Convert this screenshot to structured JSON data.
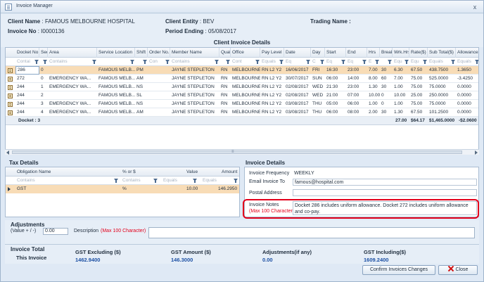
{
  "window": {
    "title": "Invoice Manager",
    "close_glyph": "x"
  },
  "header": {
    "client_name_label": "Client Name",
    "client_name": "FAMOUS MELBOURNE HOSPITAL",
    "client_entity_label": "Client Entity",
    "client_entity": "BEV",
    "trading_name_label": "Trading Name :",
    "invoice_no_label": "Invoice No",
    "invoice_no": "I0000136",
    "period_ending_label": "Period Ending",
    "period_ending": "05/08/2017",
    "colon": ":"
  },
  "client_invoice_details": {
    "title": "Client Invoice Details",
    "columns": [
      "Docket No",
      "Seq.",
      "Area",
      "Service Location",
      "Shift",
      "Order No.",
      "Member Name",
      "Qual",
      "Office",
      "Pay Level",
      "Date",
      "Day",
      "Start",
      "End",
      "Hrs",
      "Break",
      "Wrk.Hrs",
      "Rate($)",
      "Sub Total($)",
      "Allowances ($"
    ],
    "filter_placeholders": [
      "Contai",
      "",
      "Contains",
      "",
      "",
      "Con",
      "Contains",
      "",
      "Cont",
      "Equals",
      "Eq",
      "C",
      "Eq",
      "Eq",
      "E",
      "",
      "Equ",
      "Equ",
      "Equals",
      "Equals"
    ],
    "rows": [
      [
        "286",
        "0",
        "",
        "FAMOUS MELB...",
        "PM",
        "",
        "JAYNE STEPLETON",
        "RN",
        "MELBOURNE",
        "RN L2 Y2",
        "16/06/2017",
        "FRI",
        "16:30",
        "23:00",
        "7.00",
        "30",
        "6.30",
        "67.50",
        "438.7500",
        "1.3650"
      ],
      [
        "272",
        "0",
        "EMERGENCY WA...",
        "FAMOUS MELB...",
        "AM",
        "",
        "JAYNE STEPLETON",
        "RN",
        "MELBOURNE",
        "RN L2 Y2",
        "30/07/2017",
        "SUN",
        "06:00",
        "14:00",
        "8.00",
        "60",
        "7.00",
        "75.00",
        "525.0000",
        "-3.4250"
      ],
      [
        "244",
        "1",
        "EMERGENCY WA...",
        "FAMOUS MELB...",
        "NS",
        "",
        "JAYNE STEPLETON",
        "RN",
        "MELBOURNE",
        "RN L2 Y2",
        "02/08/2017",
        "WED",
        "21:30",
        "23:00",
        "1.30",
        "30",
        "1.00",
        "75.00",
        "75.0000",
        "0.0000"
      ],
      [
        "244",
        "2",
        "",
        "FAMOUS MELB...",
        "SL",
        "",
        "JAYNE STEPLETON",
        "RN",
        "MELBOURNE",
        "RN L2 Y2",
        "02/08/2017",
        "WED",
        "21:00",
        "07:00",
        "10.00",
        "0",
        "10.00",
        "25.00",
        "250.0000",
        "0.0000"
      ],
      [
        "244",
        "3",
        "EMERGENCY WA...",
        "FAMOUS MELB...",
        "NS",
        "",
        "JAYNE STEPLETON",
        "RN",
        "MELBOURNE",
        "RN L2 Y2",
        "03/08/2017",
        "THU",
        "05:00",
        "06:00",
        "1.00",
        "0",
        "1.00",
        "75.00",
        "75.0000",
        "0.0000"
      ],
      [
        "244",
        "4",
        "EMERGENCY WA...",
        "FAMOUS MELB...",
        "AM",
        "",
        "JAYNE STEPLETON",
        "RN",
        "MELBOURNE",
        "RN L2 Y2",
        "03/08/2017",
        "THU",
        "06:00",
        "08:00",
        "2.00",
        "30",
        "1.30",
        "67.50",
        "101.2500",
        "0.0000"
      ]
    ],
    "totals": {
      "docket_label": "Docket : 3",
      "wrk_hrs": "27.00",
      "rate": "$64.17",
      "sub_total": "$1,465.0000",
      "allowances": "-$2.0600"
    },
    "scroll_mid": "≡"
  },
  "tax_details": {
    "title": "Tax Details",
    "columns": [
      "Obligation Name",
      "% or $",
      "Value",
      "Amount"
    ],
    "filters": [
      "Contains",
      "Contains",
      "Equals",
      "Equals"
    ],
    "rows": [
      [
        "GST",
        "%",
        "10.00",
        "146.2950"
      ]
    ]
  },
  "invoice_details": {
    "title": "Invoice Details",
    "frequency_label": "Invoice Frequency",
    "frequency": "WEEKLY",
    "email_label": "Email Invoice To",
    "email": "famous@hospital.com",
    "postal_label": "Postal Address",
    "postal": "",
    "notes_label": "Invoice Notes",
    "notes_hint": "(Max 100 Character)",
    "notes": "Docket 286 includes uniform allowance. Docket 272 includes uniform allowance and co-pay."
  },
  "adjustments": {
    "title": "Adjustments",
    "sign_label": "(Value + / -)",
    "value": "0.00",
    "description_label": "Description",
    "description_hint": "(Max 100 Character)",
    "description": ""
  },
  "invoice_total": {
    "title": "Invoice Total",
    "row_label": "This Invoice",
    "gst_excl_label": "GST Excluding ($)",
    "gst_excl": "1462.9400",
    "gst_amt_label": "GST Amount ($)",
    "gst_amt": "146.3000",
    "adj_label": "Adjustments(if any)",
    "adj": "0.00",
    "gst_incl_label": "GST Including($)",
    "gst_incl": "1609.2400"
  },
  "buttons": {
    "confirm": "Confirm Invoices Changes",
    "close": "Close"
  },
  "colors": {
    "accent_red": "#e3001b",
    "value_blue": "#1b4fa3",
    "selected_row": "#f8dcb6"
  }
}
